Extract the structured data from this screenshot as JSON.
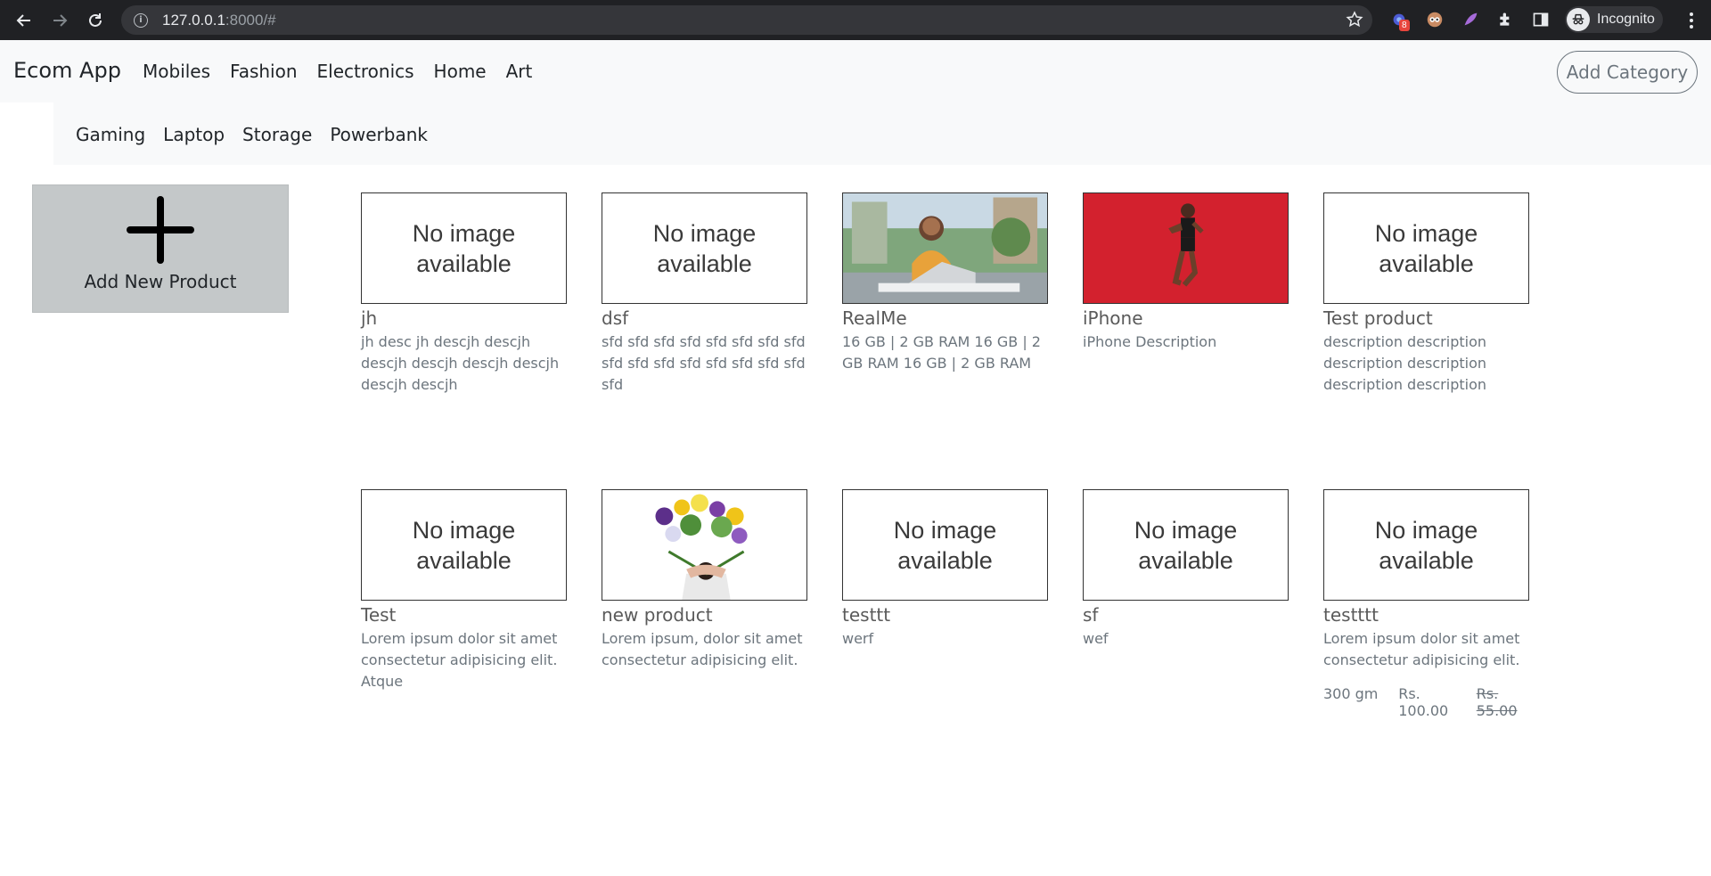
{
  "browser": {
    "url_host": "127.0.0.1",
    "url_rest": ":8000/#",
    "extension_badge": "8",
    "profile_label": "Incognito"
  },
  "navbar": {
    "brand": "Ecom App",
    "categories": [
      "Mobiles",
      "Fashion",
      "Electronics",
      "Home",
      "Art"
    ],
    "add_category_label": "Add Category"
  },
  "subnav": {
    "categories": [
      "Gaming",
      "Laptop",
      "Storage",
      "Powerbank"
    ]
  },
  "add_product": {
    "label": "Add New Product"
  },
  "no_image_text": "No image available",
  "products": [
    {
      "title": "jh",
      "desc": "jh desc jh descjh descjh descjh descjh descjh descjh descjh descjh",
      "image": "none"
    },
    {
      "title": "dsf",
      "desc": "sfd sfd sfd sfd sfd sfd sfd sfd sfd sfd sfd sfd sfd sfd sfd sfd sfd",
      "image": "none"
    },
    {
      "title": "RealMe",
      "desc": "16 GB | 2 GB RAM 16 GB | 2 GB RAM 16 GB | 2 GB RAM",
      "image": "woman-laptop-photo"
    },
    {
      "title": "iPhone",
      "desc": "iPhone Description",
      "image": "woman-fitness-photo"
    },
    {
      "title": "Test product",
      "desc": "description description description description description description",
      "image": "none"
    },
    {
      "title": "Test",
      "desc": "Lorem ipsum dolor sit amet consectetur adipisicing elit. Atque",
      "image": "none"
    },
    {
      "title": "new product",
      "desc": "Lorem ipsum, dolor sit amet consectetur adipisicing elit.",
      "image": "flower-bouquet-photo"
    },
    {
      "title": "testtt",
      "desc": "werf",
      "image": "none"
    },
    {
      "title": "sf",
      "desc": "wef",
      "image": "none"
    },
    {
      "title": "testttt",
      "desc": "Lorem ipsum dolor sit amet consectetur adipisicing elit.",
      "image": "none",
      "quantity": "300 gm",
      "price": "Rs. 100.00",
      "old_price": "Rs. 55.00"
    }
  ]
}
